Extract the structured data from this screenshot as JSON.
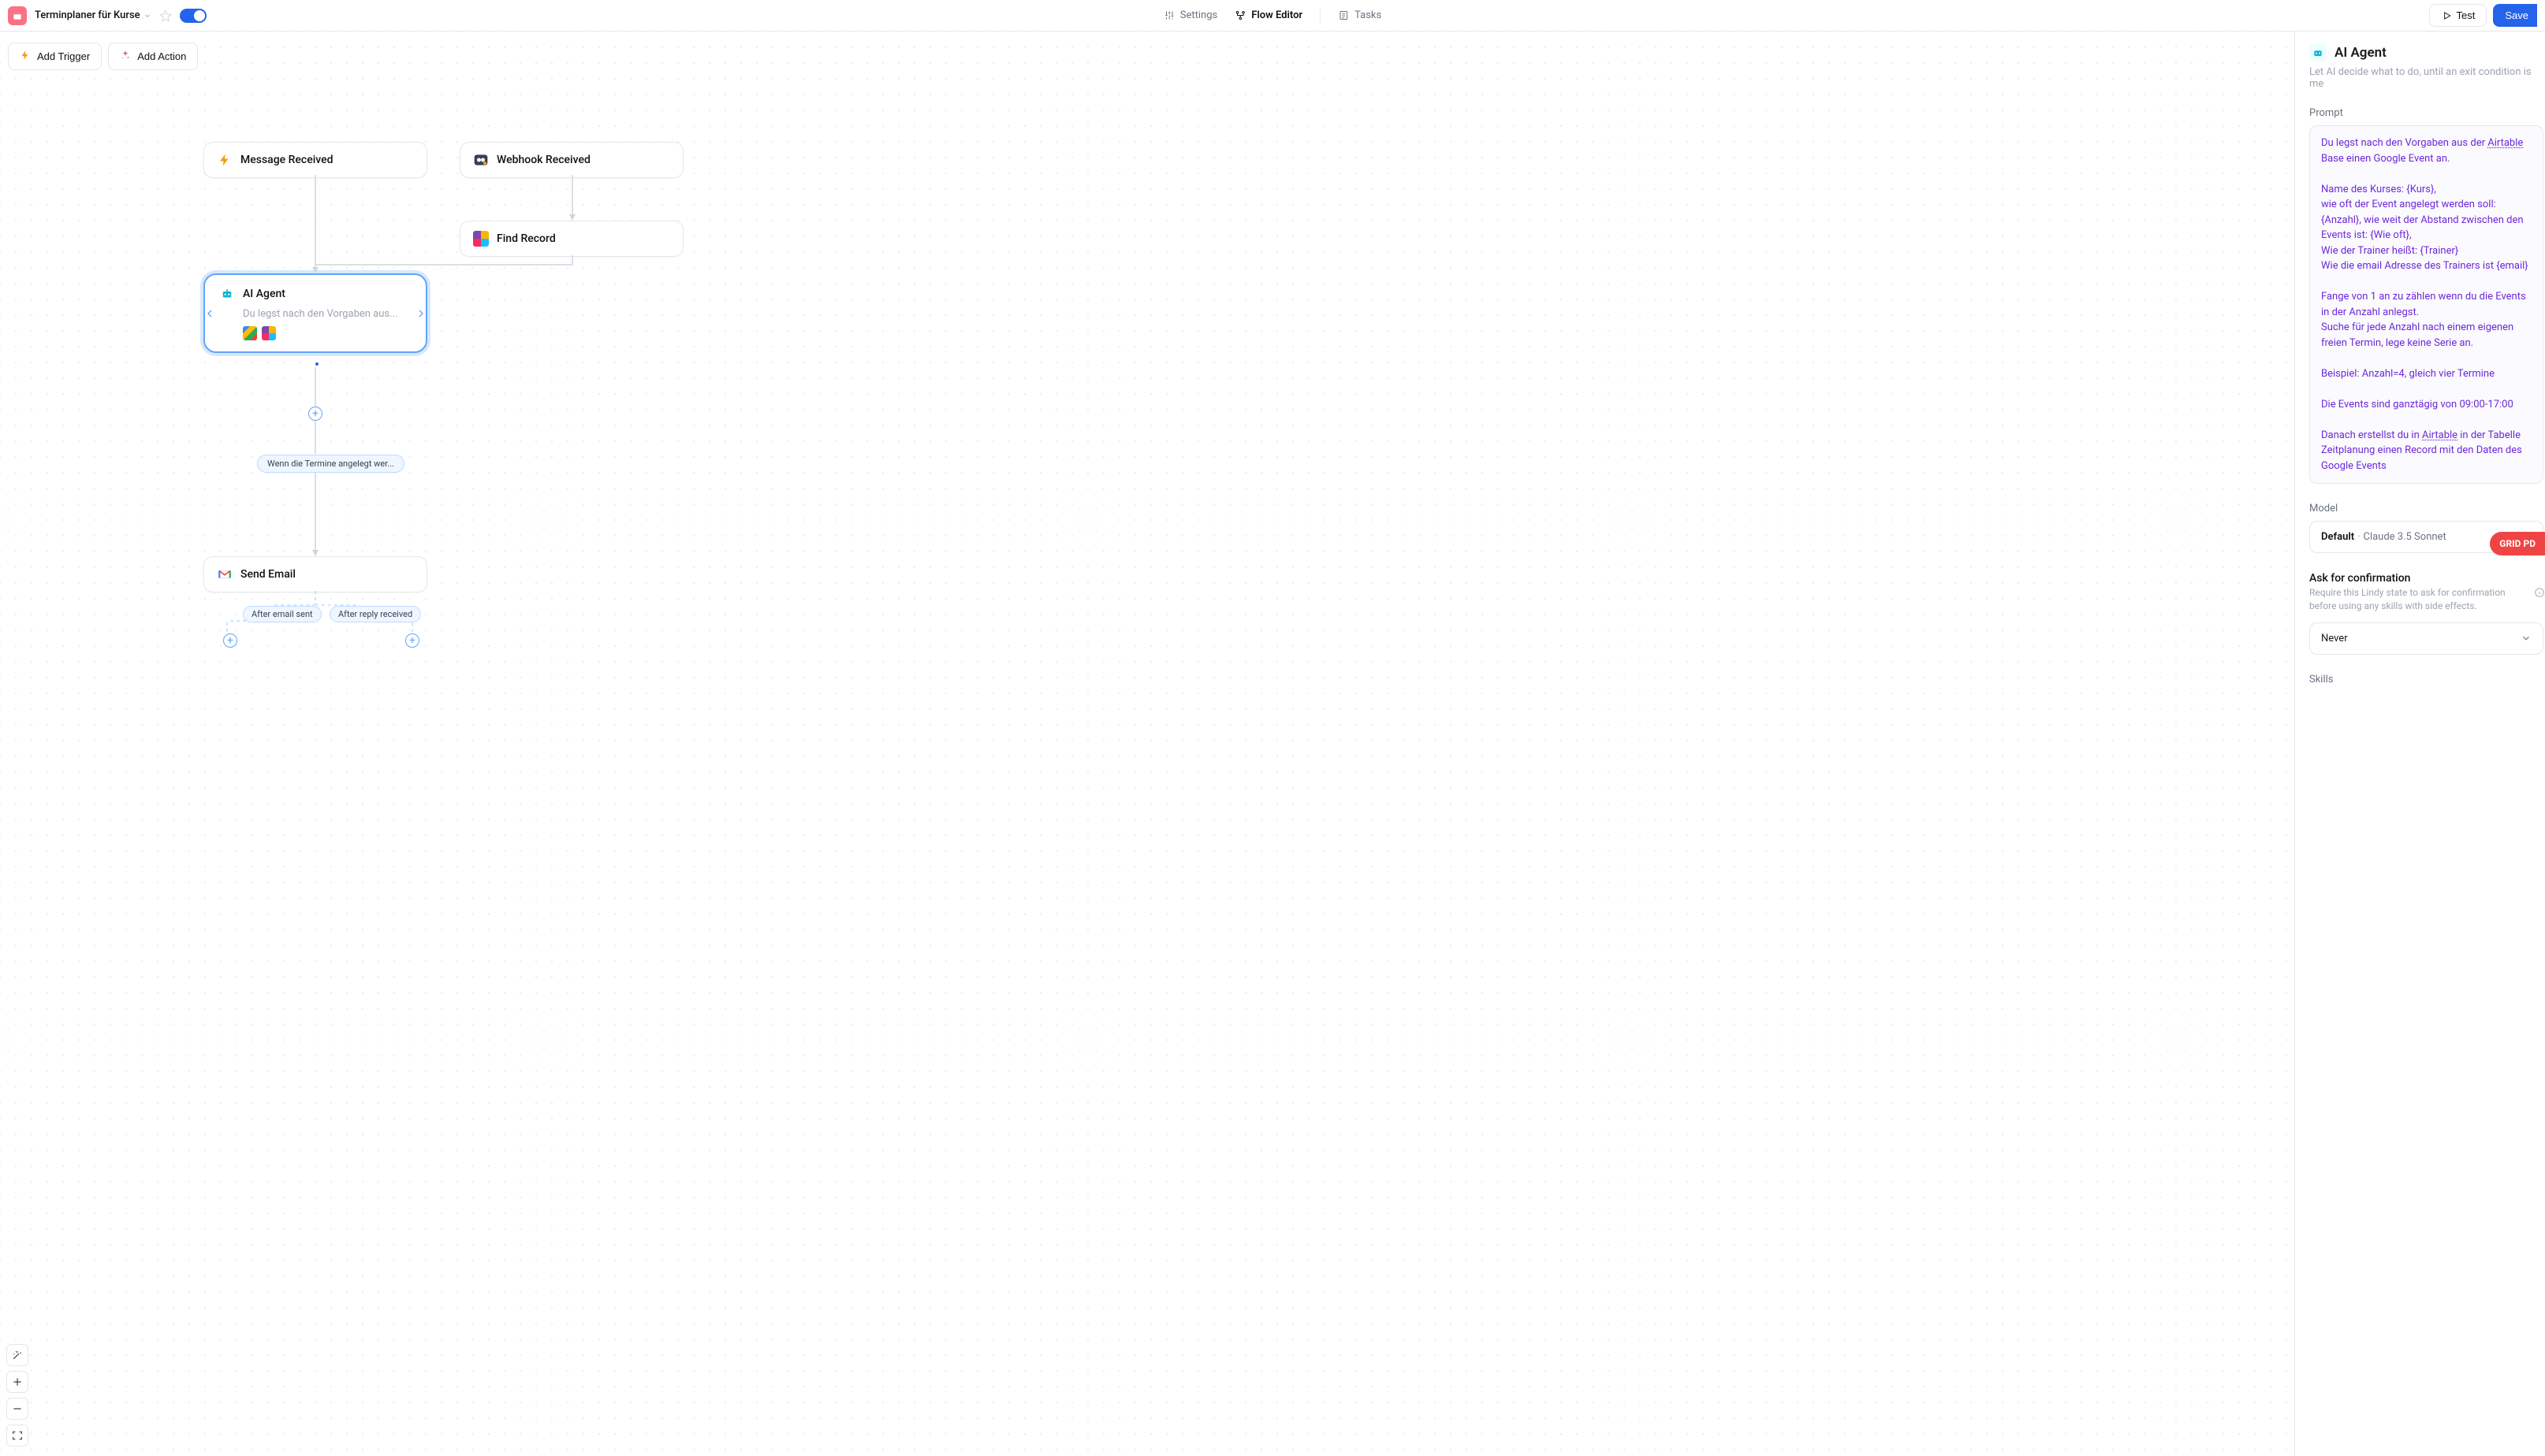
{
  "header": {
    "title": "Terminplaner für Kurse",
    "nav": {
      "settings": "Settings",
      "flow_editor": "Flow Editor",
      "tasks": "Tasks"
    },
    "buttons": {
      "test": "Test",
      "save": "Save"
    }
  },
  "canvas": {
    "toolbar": {
      "add_trigger": "Add Trigger",
      "add_action": "Add Action"
    },
    "nodes": {
      "message_received": "Message Received",
      "webhook_received": "Webhook Received",
      "find_record": "Find Record",
      "ai_agent": {
        "title": "AI Agent",
        "subtitle": "Du legst nach den Vorgaben aus..."
      },
      "send_email": "Send Email"
    },
    "condition_main": "Wenn die Termine angelegt wer...",
    "branch_left": "After email sent",
    "branch_right": "After reply received"
  },
  "panel": {
    "title": "AI Agent",
    "desc": "Let AI decide what to do, until an exit condition is me",
    "prompt_label": "Prompt",
    "prompt_p1a": "Du legst nach den Vorgaben aus der ",
    "prompt_p1b": "Airtable",
    "prompt_p1c": " Base einen Google Event an.",
    "prompt_p2": "Name des Kurses: {Kurs},\nwie oft der Event angelegt werden soll: {Anzahl}, wie weit der Abstand zwischen den Events ist: {Wie oft},\nWie der Trainer heißt: {Trainer}\nWie die email Adresse des Trainers ist {email}",
    "prompt_p3": "Fange von 1 an zu zählen wenn du die Events in der Anzahl anlegst.\nSuche für jede Anzahl nach einem eigenen freien Termin, lege keine Serie an.",
    "prompt_p4": "Beispiel: Anzahl=4, gleich vier Termine",
    "prompt_p5": "Die Events sind ganztägig von 09:00-17:00",
    "prompt_p6a": "Danach erstellst du in ",
    "prompt_p6b": "Airtable",
    "prompt_p6c": " in der Tabelle Zeitplanung einen Record mit den Daten des Google Events",
    "model_label": "Model",
    "model_default": "Default",
    "model_name": "Claude 3.5 Sonnet",
    "confirm_label": "Ask for confirmation",
    "confirm_help": "Require this Lindy state to ask for confirmation before using any skills with side effects.",
    "confirm_value": "Never",
    "skills_label": "Skills",
    "badge": "GRID PD"
  }
}
